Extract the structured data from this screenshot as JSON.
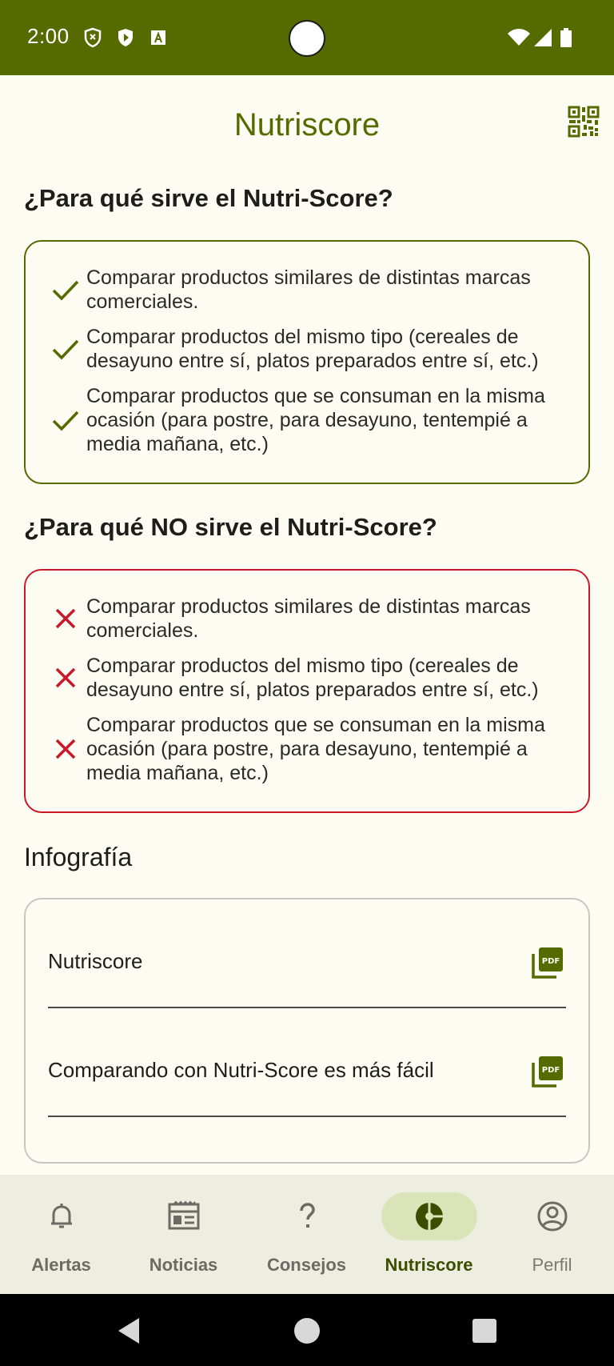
{
  "status_bar": {
    "time": "2:00",
    "icons": [
      "shield-icon",
      "play-protect-icon",
      "text-icon",
      "wifi-icon",
      "signal-icon",
      "battery-icon"
    ]
  },
  "app_bar": {
    "title": "Nutriscore",
    "action_icon": "qr-code-icon"
  },
  "sirve": {
    "title": "¿Para qué sirve el Nutri-Score?",
    "accent": "#556b00",
    "items": [
      "Comparar productos similares de distintas marcas comerciales.",
      "Comparar productos del mismo tipo (cereales de desayuno entre sí, platos preparados entre sí, etc.)",
      "Comparar productos que se consuman en la misma ocasión (para postre, para desayuno, tentempié a media mañana, etc.)"
    ]
  },
  "no_sirve": {
    "title": "¿Para qué NO sirve el Nutri-Score?",
    "accent": "#c8192a",
    "items": [
      "Comparar productos similares de distintas marcas comerciales.",
      "Comparar productos del mismo tipo (cereales de desayuno entre sí, platos preparados entre sí, etc.)",
      "Comparar productos que se consuman en la misma ocasión (para postre, para desayuno, tentempié a media mañana, etc.)"
    ]
  },
  "infografia": {
    "title": "Infografía",
    "items": [
      {
        "label": "Nutriscore",
        "icon": "pdf-icon"
      },
      {
        "label": "Comparando con Nutri-Score es más fácil",
        "icon": "pdf-icon"
      }
    ]
  },
  "bottom_nav": {
    "items": [
      {
        "label": "Alertas",
        "icon": "bell-icon"
      },
      {
        "label": "Noticias",
        "icon": "newspaper-icon"
      },
      {
        "label": "Consejos",
        "icon": "question-icon"
      },
      {
        "label": "Nutriscore",
        "icon": "nutriscore-icon",
        "active": true
      },
      {
        "label": "Perfil",
        "icon": "profile-icon"
      }
    ]
  },
  "colors": {
    "primary": "#556b00",
    "background": "#fdfcf3",
    "nav_background": "#eeeee0",
    "nav_active_pill": "#d9e4b8",
    "negative": "#c8192a"
  }
}
